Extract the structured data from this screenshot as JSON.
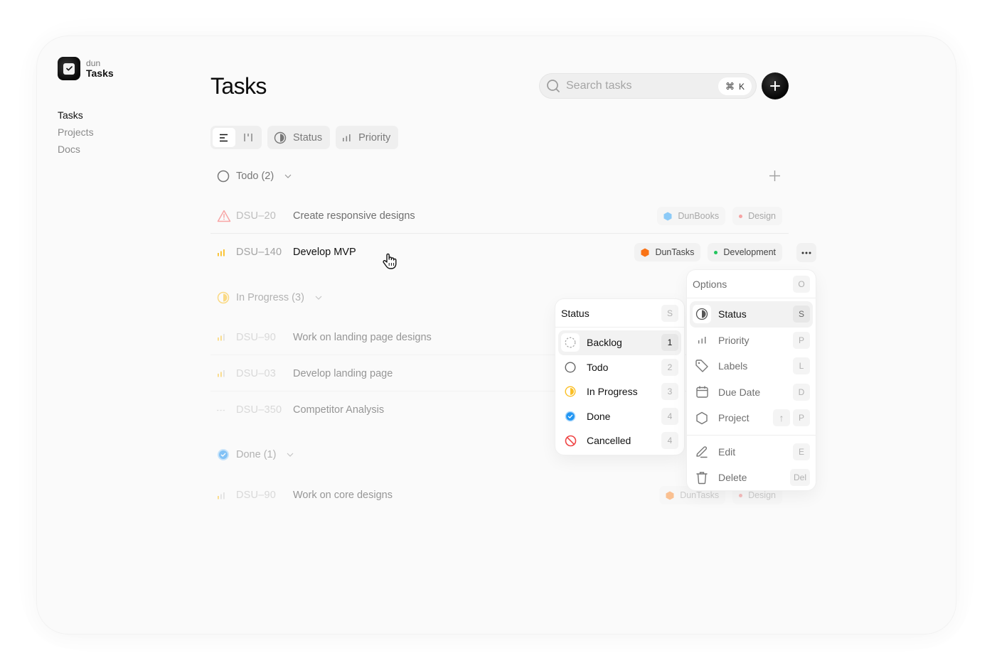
{
  "app": {
    "logo_small": "dun",
    "logo_big": "Tasks"
  },
  "sidebar": {
    "items": [
      {
        "label": "Tasks",
        "active": true
      },
      {
        "label": "Projects",
        "active": false
      },
      {
        "label": "Docs",
        "active": false
      }
    ]
  },
  "header": {
    "title": "Tasks",
    "search_placeholder": "Search tasks",
    "search_value": "",
    "search_shortcut_symbol": "⌘",
    "search_shortcut_key": "K"
  },
  "toolbar": {
    "views": [
      "list-view",
      "board-view"
    ],
    "active_view": "list-view",
    "status_label": "Status",
    "priority_label": "Priority"
  },
  "groups": [
    {
      "name": "Todo",
      "label": "Todo (2)",
      "count": 2,
      "tasks": [
        {
          "id": "DSU–20",
          "title": "Create responsive designs",
          "priority": "urgent",
          "project": "DunBooks",
          "project_color": "#7cc0f5",
          "label": "Design",
          "label_color": "#f28b8b"
        },
        {
          "id": "DSU–140",
          "title": "Develop MVP",
          "priority": "high",
          "project": "DunTasks",
          "project_color": "#f97316",
          "label": "Development",
          "label_color": "#22c55e"
        }
      ]
    },
    {
      "name": "In Progress",
      "label": "In Progress (3)",
      "count": 3,
      "tasks": [
        {
          "id": "DSU–90",
          "title": "Work on landing page designs",
          "priority": "medium"
        },
        {
          "id": "DSU–03",
          "title": "Develop landing page",
          "priority": "high"
        },
        {
          "id": "DSU–350",
          "title": "Competitor Analysis",
          "priority": "none"
        }
      ]
    },
    {
      "name": "Done",
      "label": "Done (1)",
      "count": 1,
      "tasks": [
        {
          "id": "DSU–90",
          "title": "Work on core designs",
          "priority": "medium",
          "project": "DunTasks",
          "project_color": "#fb923c",
          "label": "Design",
          "label_color": "#f28b8b"
        }
      ]
    }
  ],
  "status_menu": {
    "title": "Status",
    "shortcut": "S",
    "items": [
      {
        "label": "Backlog",
        "key": "1",
        "icon": "backlog-icon",
        "highlighted": true
      },
      {
        "label": "Todo",
        "key": "2",
        "icon": "todo-icon"
      },
      {
        "label": "In Progress",
        "key": "3",
        "icon": "in-progress-icon",
        "color": "#fbbf24"
      },
      {
        "label": "Done",
        "key": "4",
        "icon": "done-icon",
        "color": "#2196f3"
      },
      {
        "label": "Cancelled",
        "key": "4",
        "icon": "cancelled-icon",
        "color": "#ef4444"
      }
    ]
  },
  "options_menu": {
    "title": "Options",
    "shortcut": "O",
    "items": [
      {
        "label": "Status",
        "keys": [
          "S"
        ],
        "icon": "status-icon",
        "highlighted": true
      },
      {
        "label": "Priority",
        "keys": [
          "P"
        ],
        "icon": "priority-icon"
      },
      {
        "label": "Labels",
        "keys": [
          "L"
        ],
        "icon": "tag-icon"
      },
      {
        "label": "Due Date",
        "keys": [
          "D"
        ],
        "icon": "calendar-icon"
      },
      {
        "label": "Project",
        "keys": [
          "↑",
          "P"
        ],
        "icon": "hexagon-icon"
      },
      {
        "label": "Edit",
        "keys": [
          "E"
        ],
        "icon": "pencil-icon"
      },
      {
        "label": "Delete",
        "keys": [
          "Del"
        ],
        "icon": "trash-icon"
      }
    ]
  },
  "colors": {
    "accent": "#111111",
    "in_progress": "#fbbf24",
    "done": "#2196f3",
    "urgent": "#f87171",
    "cancelled": "#ef4444"
  }
}
